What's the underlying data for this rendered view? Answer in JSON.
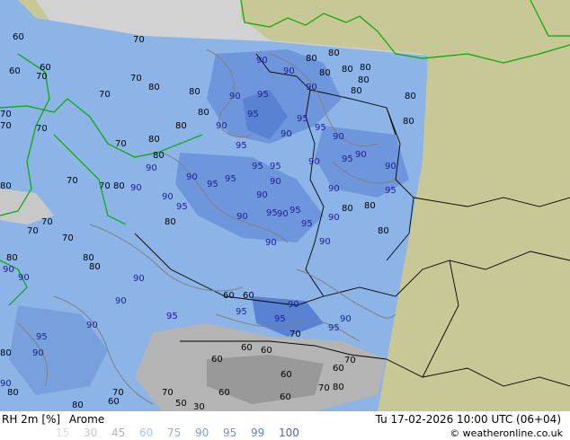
{
  "map": {
    "colors": {
      "land": "#c8c896",
      "sea": "#d2d2d2",
      "model_field": "#8cb4e6",
      "high_humidity": "#6e96dc",
      "very_high": "#5a82d2",
      "dry": "#b4b4b4",
      "dry_dark": "#999999",
      "coastline": "#00aa00",
      "border": "#000000",
      "contour": "#808080",
      "label_blue": "#1e1e96",
      "label_dark": "#000000"
    },
    "labels_90": [
      "90",
      "90",
      "90",
      "90",
      "90",
      "90",
      "90",
      "90",
      "90",
      "90",
      "90",
      "90",
      "90",
      "90",
      "90",
      "90",
      "90",
      "90",
      "90",
      "90",
      "90",
      "90",
      "90",
      "90",
      "90",
      "90",
      "90",
      "90",
      "90",
      "90"
    ],
    "labels_95": [
      "95",
      "95",
      "95",
      "95",
      "95",
      "95",
      "95",
      "95",
      "95",
      "95",
      "95",
      "95",
      "95",
      "95",
      "95",
      "95",
      "95",
      "95",
      "95",
      "95"
    ],
    "labels_80": [
      "80",
      "80",
      "80",
      "80",
      "80",
      "80",
      "80",
      "80",
      "80",
      "80",
      "80",
      "80",
      "80",
      "80",
      "80",
      "80",
      "80",
      "80",
      "80",
      "80",
      "80",
      "80",
      "80",
      "80"
    ],
    "labels_70": [
      "70",
      "70",
      "70",
      "70",
      "70",
      "70",
      "70",
      "70",
      "70",
      "70",
      "70",
      "70",
      "70",
      "70",
      "70",
      "70",
      "70",
      "70"
    ],
    "labels_60": [
      "60",
      "60",
      "60",
      "60",
      "60",
      "60",
      "60",
      "60",
      "60",
      "60",
      "60",
      "60",
      "60"
    ],
    "labels_50": [
      "50",
      "50",
      "30"
    ]
  },
  "legend": {
    "variable": "RH 2m [%]",
    "model": "Arome",
    "valid_time": "Tu 17-02-2026 10:00 UTC (06+04)",
    "credit": "© weatheronline.co.uk",
    "scale": [
      {
        "value": "15",
        "color": "#dcdcdc"
      },
      {
        "value": "30",
        "color": "#c8c8c8"
      },
      {
        "value": "45",
        "color": "#b4b4b4"
      },
      {
        "value": "60",
        "color": "#a0c8f0"
      },
      {
        "value": "75",
        "color": "#8cb4e6"
      },
      {
        "value": "90",
        "color": "#78a0dc"
      },
      {
        "value": "95",
        "color": "#6e96dc"
      },
      {
        "value": "99",
        "color": "#5a82d2"
      },
      {
        "value": "100",
        "color": "#4664c8"
      }
    ]
  }
}
